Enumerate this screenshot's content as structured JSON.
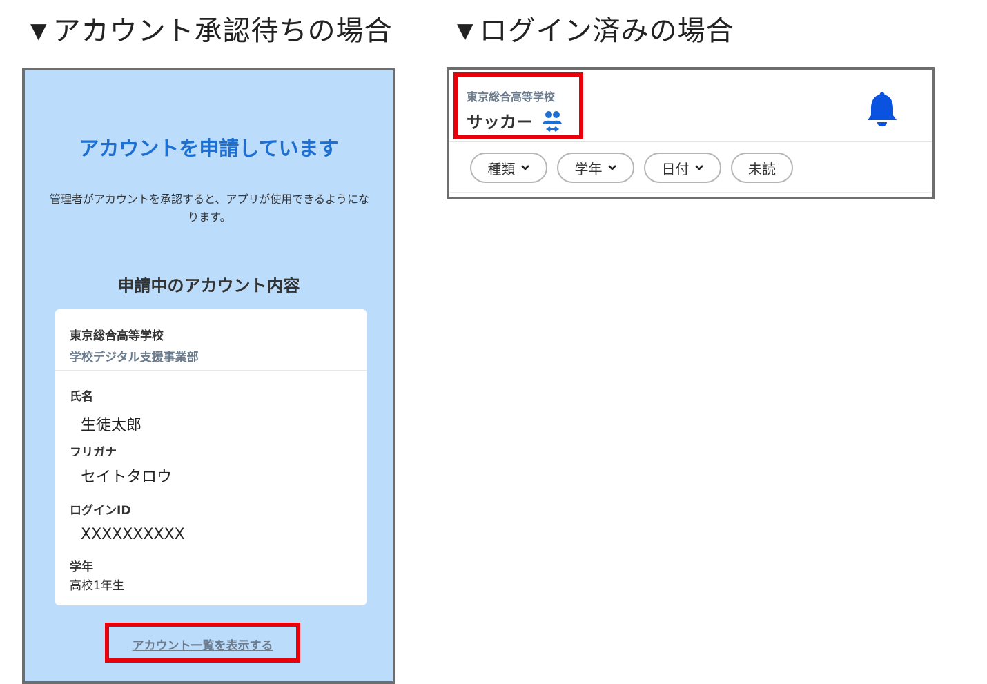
{
  "headings": {
    "pending": "▼アカウント承認待ちの場合",
    "logged_in": "▼ログイン済みの場合"
  },
  "pending_screen": {
    "title": "アカウントを申請しています",
    "description": "管理者がアカウントを承認すると、アプリが使用できるようになります。",
    "section_title": "申請中のアカウント内容",
    "card": {
      "school": "東京総合高等学校",
      "department": "学校デジタル支援事業部",
      "fields": [
        {
          "label": "氏名",
          "value": "生徒太郎"
        },
        {
          "label": "フリガナ",
          "value": "セイトタロウ"
        },
        {
          "label": "ログインID",
          "value": "XXXXXXXXXX"
        },
        {
          "label": "学年",
          "value": "高校1年生"
        }
      ]
    },
    "account_list_link": "アカウント一覧を表示する"
  },
  "logged_in_screen": {
    "school": "東京総合高等学校",
    "team": "サッカー",
    "icons": {
      "team_switch": "team-switch-icon",
      "notifications": "bell-icon"
    },
    "filters": [
      {
        "label": "種類",
        "has_dropdown": true
      },
      {
        "label": "学年",
        "has_dropdown": true
      },
      {
        "label": "日付",
        "has_dropdown": true
      },
      {
        "label": "未読",
        "has_dropdown": false
      }
    ]
  },
  "colors": {
    "highlight_red": "#e8000b",
    "accent_blue": "#1e6fd2",
    "phone_background": "#bcdcfc",
    "bell_blue": "#0a52e0",
    "muted_text": "#6b7b8c"
  }
}
